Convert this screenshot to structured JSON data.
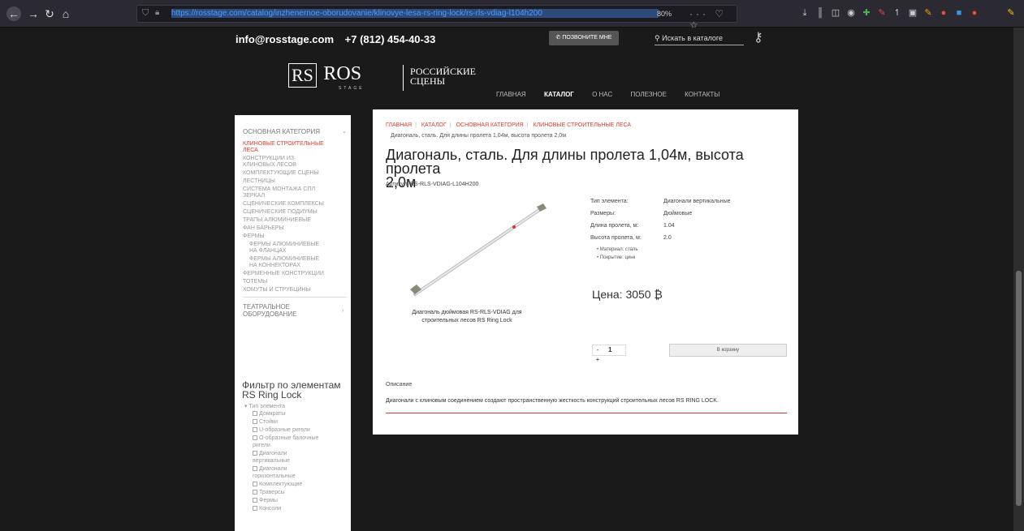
{
  "browser": {
    "url": "https://rosstage.com/catalog/inzhenernoe-oborudovanie/klinovye-lesa-rs-ring-lock/rs-rls-vdiag-l104h200",
    "zoom": "80%",
    "urlbar_icons": "··· ♡ ☆",
    "toolbar_icons": [
      "download-icon",
      "library-icon",
      "sidebar-icon",
      "reader-icon",
      "extension-icon",
      "extension-icon",
      "extension-icon",
      "extension-icon",
      "extension-icon",
      "extension-icon",
      "extension-icon",
      "extension-icon",
      "extension-icon"
    ]
  },
  "header": {
    "email": "info@rosstage.com",
    "phone": "+7 (812) 454-40-33",
    "call_button": "ПОЗВОНИТЕ МНЕ",
    "search_placeholder": "Искать в каталоге"
  },
  "logo": {
    "mono": "RS",
    "name": "ROS",
    "sub": "STAGE",
    "ru_line1": "РОССИЙСКИЕ",
    "ru_line2": "СЦЕНЫ"
  },
  "nav": [
    "ГЛАВНАЯ",
    "КАТАЛОГ",
    "О НАС",
    "ПОЛЕЗНОЕ",
    "КОНТАКТЫ"
  ],
  "sidebar": {
    "main_category": "ОСНОВНАЯ КАТЕГОРИЯ",
    "items": [
      "КЛИНОВЫЕ СТРОИТЕЛЬНЫЕ",
      "ЛЕСА",
      "КОНСТРУКЦИИ ИЗ",
      "КЛИНОВЫХ ЛЕСОВ",
      "КОМПЛЕКТУЮЩИЕ СЦЕНЫ",
      "ЛЕСТНИЦЫ",
      "СИСТЕМА МОНТАЖА СПЛ",
      "ЗЕРКАЛ",
      "СЦЕНИЧЕСКИЕ КОМПЛЕКСЫ",
      "СЦЕНИЧЕСКИЕ ПОДИУМЫ",
      "ТРАПЫ АЛЮМИНИЕВЫЕ",
      "ФАН БАРЬЕРЫ",
      "ФЕРМЫ",
      "ФЕРМЫ АЛЮМИНИЕВЫЕ",
      "НА ФЛАНЦАХ",
      "ФЕРМЫ АЛЮМИНИЕВЫЕ",
      "НА КОННЕКТОРАХ",
      "ФЕРМЕННЫЕ КОНСТРУКЦИИ",
      "ТОТЕМЫ",
      "ХОМУТЫ И СТРУБЦИНЫ"
    ],
    "theatrical_1": "ТЕАТРАЛЬНОЕ",
    "theatrical_2": "ОБОРУДОВАНИЕ",
    "filter_title_1": "Фильтр по элементам",
    "filter_title_2": "RS Ring Lock",
    "filter_group": "Тип элемента",
    "filter_options": [
      "Домкраты",
      "Стойки",
      "U-образные ригели",
      "O-образные балочные",
      "ригели",
      "Диагонали",
      "вертикальные",
      "Диагонали",
      "горизонтальные",
      "Комплектующие",
      "Траверсы",
      "Фермы",
      "Консоли"
    ]
  },
  "product": {
    "breadcrumbs": [
      "ГЛАВНАЯ",
      "КАТАЛОГ",
      "ОСНОВНАЯ КАТЕГОРИЯ",
      "КЛИНОВЫЕ СТРОИТЕЛЬНЫЕ ЛЕСА"
    ],
    "crumb_current": "Диагональ, сталь. Для длины пролета 1,04м, высота пролета 2,0м",
    "title_line1": "Диагональ, сталь. Для длины пролета 1,04м, высота пролета",
    "title_line2": "2,0м",
    "article": "Артикул: RS-RLS-VDIAG-L104H200",
    "image_caption_1": "Диагональ дюймовая RS-RLS-VDIAG для",
    "image_caption_2": "строительных лесов RS Ring Lock",
    "specs": [
      {
        "k": "Тип элемента:",
        "v": "Диагонали вертикальные"
      },
      {
        "k": "Размеры:",
        "v": "Дюймовые"
      },
      {
        "k": "Длина пролета, м:",
        "v": "1.04"
      },
      {
        "k": "Высота пролета, м:",
        "v": "2.0"
      }
    ],
    "bullets": [
      "• Материал: сталь",
      "• Покрытие: цинк"
    ],
    "price": "Цена: 3050 ₿",
    "qty_minus": "-",
    "qty_value": "1",
    "qty_plus": "+",
    "cart_button": "В корзину",
    "desc_label": "Описание",
    "desc_text": "Диагонали с клиновым соединением создают пространственную жесткость конструкций строительных лесов RS RING LOCK."
  }
}
